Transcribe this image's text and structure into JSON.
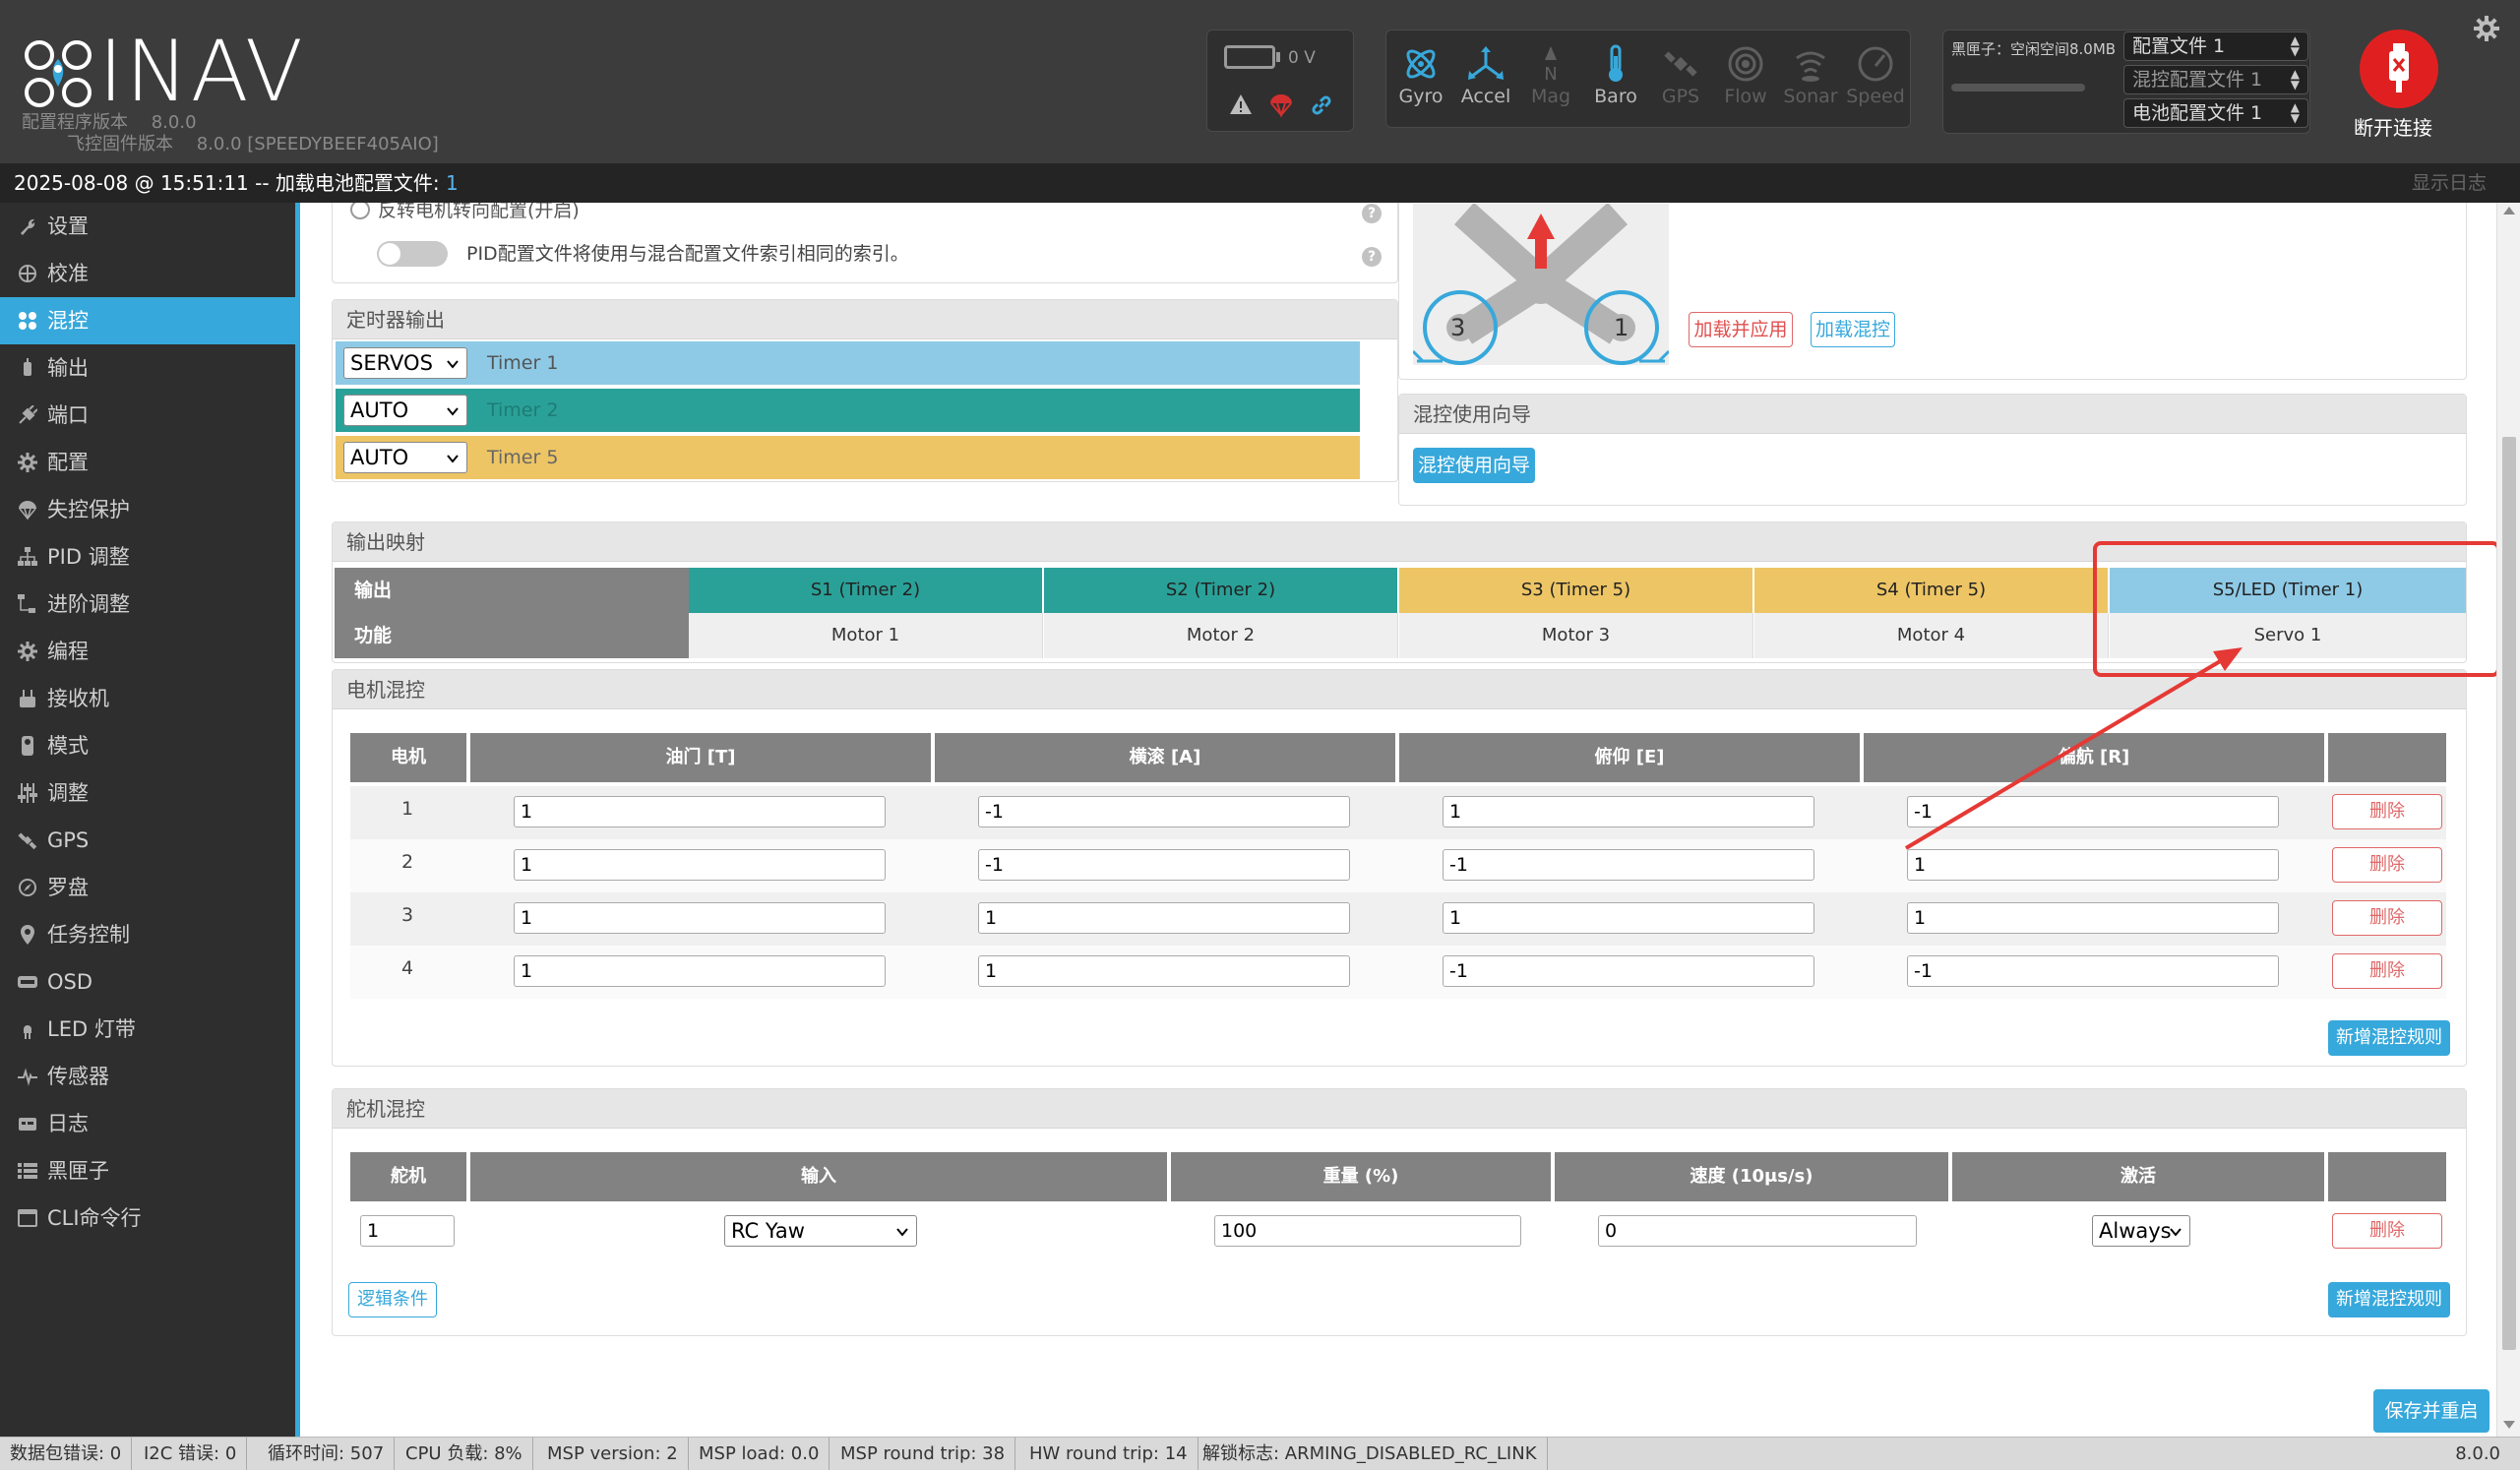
{
  "app": {
    "name": "INAV",
    "config_version_label": "配置程序版本",
    "config_version": "8.0.0",
    "fw_version_label": "飞控固件版本",
    "fw_version": "8.0.0 [SPEEDYBEEF405AIO]"
  },
  "battery": {
    "voltage": "0 V"
  },
  "sensors": [
    {
      "name": "Gyro",
      "state": "on"
    },
    {
      "name": "Accel",
      "state": "on"
    },
    {
      "name": "Mag",
      "state": "off"
    },
    {
      "name": "Baro",
      "state": "on"
    },
    {
      "name": "GPS",
      "state": "off"
    },
    {
      "name": "Flow",
      "state": "off"
    },
    {
      "name": "Sonar",
      "state": "off"
    },
    {
      "name": "Speed",
      "state": "off"
    }
  ],
  "blackbox": {
    "text": "黑匣子：空闲空间8.0MB"
  },
  "profiles": {
    "config_profile": "配置文件 1",
    "mixer_profile": "混控配置文件 1",
    "battery_profile": "电池配置文件 1"
  },
  "disconnect_label": "断开连接",
  "log_strip": {
    "message": "2025-08-08 @ 15:51:11 -- 加载电池配置文件: ",
    "number": "1",
    "show_log": "显示日志"
  },
  "sidebar": {
    "items": [
      {
        "label": "设置"
      },
      {
        "label": "校准"
      },
      {
        "label": "混控"
      },
      {
        "label": "输出"
      },
      {
        "label": "端口"
      },
      {
        "label": "配置"
      },
      {
        "label": "失控保护"
      },
      {
        "label": "PID 调整"
      },
      {
        "label": "进阶调整"
      },
      {
        "label": "编程"
      },
      {
        "label": "接收机"
      },
      {
        "label": "模式"
      },
      {
        "label": "调整"
      },
      {
        "label": "GPS"
      },
      {
        "label": "罗盘"
      },
      {
        "label": "任务控制"
      },
      {
        "label": "OSD"
      },
      {
        "label": "LED 灯带"
      },
      {
        "label": "传感器"
      },
      {
        "label": "日志"
      },
      {
        "label": "黑匣子"
      },
      {
        "label": "CLI命令行"
      }
    ]
  },
  "options": {
    "cut_text": "反转电机转向配置(开启)",
    "pid_profile_text": "PID配置文件将使用与混合配置文件索引相同的索引。"
  },
  "timer_output": {
    "title": "定时器输出",
    "rows": [
      {
        "mode": "SERVOS",
        "timer": "Timer 1",
        "color": "#8ecae6"
      },
      {
        "mode": "AUTO",
        "timer": "Timer 2",
        "color": "#2aa198"
      },
      {
        "mode": "AUTO",
        "timer": "Timer 5",
        "color": "#edc565"
      }
    ]
  },
  "preview": {
    "motor_labels": [
      "3",
      "1"
    ],
    "load_apply": "加载并应用",
    "load_mixer": "加载混控"
  },
  "wizard": {
    "title": "混控使用向导",
    "button": "混控使用向导"
  },
  "output_mapping": {
    "title": "输出映射",
    "row_output": "输出",
    "row_function": "功能",
    "columns": [
      {
        "output": "S1 (Timer 2)",
        "function": "Motor 1",
        "color": "#2aa198"
      },
      {
        "output": "S2 (Timer 2)",
        "function": "Motor 2",
        "color": "#2aa198"
      },
      {
        "output": "S3 (Timer 5)",
        "function": "Motor 3",
        "color": "#edc565"
      },
      {
        "output": "S4 (Timer 5)",
        "function": "Motor 4",
        "color": "#edc565"
      },
      {
        "output": "S5/LED (Timer 1)",
        "function": "Servo 1",
        "color": "#8ecae6"
      }
    ],
    "highlight_color": "#e53935"
  },
  "motor_mixer": {
    "title": "电机混控",
    "headers": [
      "电机",
      "油门 [T]",
      "横滚 [A]",
      "俯仰 [E]",
      "偏航 [R]"
    ],
    "rows": [
      {
        "n": "1",
        "t": "1",
        "a": "-1",
        "e": "1",
        "r": "-1"
      },
      {
        "n": "2",
        "t": "1",
        "a": "-1",
        "e": "-1",
        "r": "1"
      },
      {
        "n": "3",
        "t": "1",
        "a": "1",
        "e": "1",
        "r": "1"
      },
      {
        "n": "4",
        "t": "1",
        "a": "1",
        "e": "-1",
        "r": "-1"
      }
    ],
    "delete_label": "删除",
    "add_rule": "新增混控规则"
  },
  "servo_mixer": {
    "title": "舵机混控",
    "headers": [
      "舵机",
      "输入",
      "重量 (%)",
      "速度 (10μs/s)",
      "激活"
    ],
    "rows": [
      {
        "servo": "1",
        "input": "RC Yaw",
        "weight": "100",
        "speed": "0",
        "activate": "Always"
      }
    ],
    "delete_label": "删除",
    "logic_conditions": "逻辑条件",
    "add_rule": "新增混控规则"
  },
  "save_reboot": "保存并重启",
  "statusbar": {
    "items": [
      "数据包错误: 0",
      "I2C 错误: 0",
      "循环时间: 507",
      "CPU 负载: 8%",
      "MSP version: 2",
      "MSP load: 0.0",
      "MSP round trip: 38",
      "HW round trip: 14",
      "解锁标志: ARMING_DISABLED_RC_LINK"
    ],
    "version": "8.0.0"
  },
  "colors": {
    "accent": "#37a8db",
    "header_bg": "#3c3c3c",
    "sidebar_bg": "#2e2e2e",
    "danger": "#e06767"
  }
}
